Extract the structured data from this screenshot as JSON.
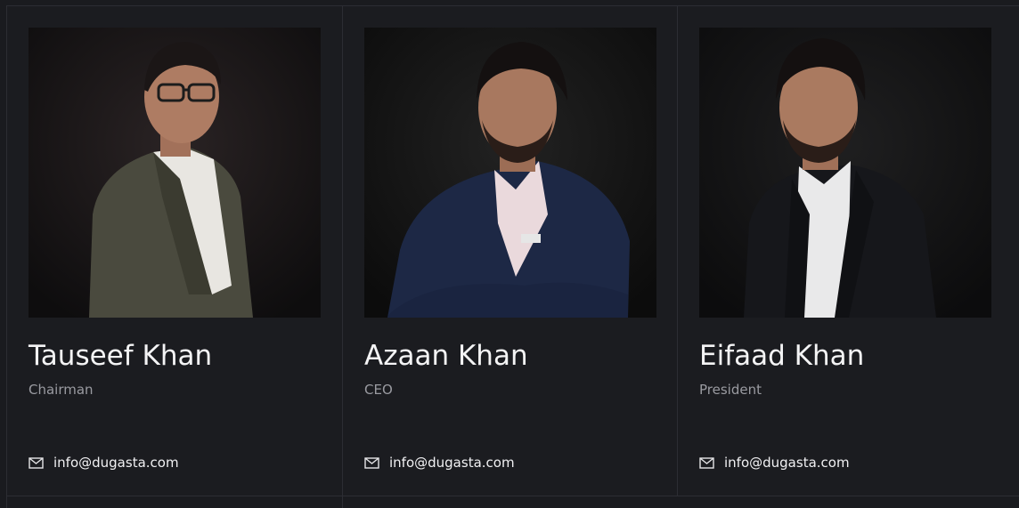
{
  "team": [
    {
      "name": "Tauseef Khan",
      "role": "Chairman",
      "email": "info@dugasta.com",
      "photo": "portrait-chairman",
      "suit_color": "#4a4a3e",
      "shirt_color": "#e8e6e1"
    },
    {
      "name": "Azaan Khan",
      "role": "CEO",
      "email": "info@dugasta.com",
      "photo": "portrait-ceo",
      "suit_color": "#1d2845",
      "shirt_color": "#ead9dc"
    },
    {
      "name": "Eifaad Khan",
      "role": "President",
      "email": "info@dugasta.com",
      "photo": "portrait-president",
      "suit_color": "#16171b",
      "shirt_color": "#e9e9ea"
    }
  ],
  "icons": {
    "email": "envelope-icon"
  },
  "colors": {
    "background": "#1a1b1f",
    "card_border": "#2c2d33",
    "name_text": "#f4f4f5",
    "role_text": "#9a9ba1"
  }
}
